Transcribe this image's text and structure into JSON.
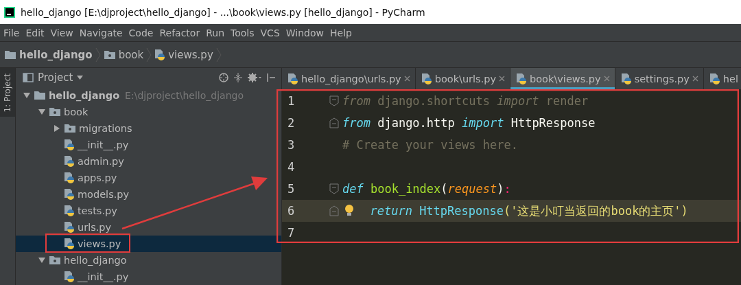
{
  "window": {
    "title": "hello_django [E:\\djproject\\hello_django] - ...\\book\\views.py [hello_django] - PyCharm"
  },
  "menu": [
    "File",
    "Edit",
    "View",
    "Navigate",
    "Code",
    "Refactor",
    "Run",
    "Tools",
    "VCS",
    "Window",
    "Help"
  ],
  "breadcrumbs": [
    {
      "label": "hello_django",
      "kind": "project"
    },
    {
      "label": "book",
      "kind": "folder"
    },
    {
      "label": "views.py",
      "kind": "file"
    }
  ],
  "side_strip": {
    "label": "1: Project"
  },
  "project_panel": {
    "title": "Project",
    "tree": [
      {
        "label": "hello_django",
        "kind": "project",
        "note": "E:\\djproject\\hello_django",
        "expanded": true,
        "selected": false,
        "children": [
          {
            "label": "book",
            "kind": "package",
            "expanded": true,
            "selected": false,
            "children": [
              {
                "label": "migrations",
                "kind": "package",
                "expanded": false,
                "selected": false
              },
              {
                "label": "__init__.py",
                "kind": "file",
                "selected": false
              },
              {
                "label": "admin.py",
                "kind": "file",
                "selected": false
              },
              {
                "label": "apps.py",
                "kind": "file",
                "selected": false
              },
              {
                "label": "models.py",
                "kind": "file",
                "selected": false
              },
              {
                "label": "tests.py",
                "kind": "file",
                "selected": false
              },
              {
                "label": "urls.py",
                "kind": "file",
                "selected": false
              },
              {
                "label": "views.py",
                "kind": "file",
                "selected": true
              }
            ]
          },
          {
            "label": "hello_django",
            "kind": "package",
            "expanded": true,
            "selected": false,
            "children": [
              {
                "label": "__init__.py",
                "kind": "file",
                "selected": false
              }
            ]
          }
        ]
      }
    ]
  },
  "tabs": [
    {
      "label": "hello_django\\urls.py",
      "selected": false,
      "closable": true
    },
    {
      "label": "book\\urls.py",
      "selected": false,
      "closable": true
    },
    {
      "label": "book\\views.py",
      "selected": true,
      "closable": true
    },
    {
      "label": "settings.py",
      "selected": false,
      "closable": true
    },
    {
      "label": "hel",
      "selected": false,
      "closable": false
    }
  ],
  "editor": {
    "lines": [
      {
        "number": "1",
        "fold_open": true,
        "fold_close": false,
        "current": false,
        "bulb": false,
        "tokens": [
          {
            "text": "from",
            "kind": "unused-kw"
          },
          {
            "text": " django.shortcuts ",
            "kind": "unused"
          },
          {
            "text": "import",
            "kind": "unused-kw"
          },
          {
            "text": " render",
            "kind": "unused"
          }
        ]
      },
      {
        "number": "2",
        "fold_open": false,
        "fold_close": true,
        "current": false,
        "bulb": false,
        "tokens": [
          {
            "text": "from",
            "kind": "kw"
          },
          {
            "text": " django.http ",
            "kind": "plain"
          },
          {
            "text": "import",
            "kind": "kw"
          },
          {
            "text": " HttpResponse",
            "kind": "plain"
          }
        ]
      },
      {
        "number": "3",
        "fold_open": false,
        "fold_close": false,
        "current": false,
        "bulb": false,
        "tokens": [
          {
            "text": "# Create your views here.",
            "kind": "comment"
          }
        ]
      },
      {
        "number": "4",
        "fold_open": false,
        "fold_close": false,
        "current": false,
        "bulb": false
      },
      {
        "number": "5",
        "fold_open": true,
        "fold_close": false,
        "current": false,
        "bulb": false,
        "tokens": [
          {
            "text": "def",
            "kind": "kw"
          },
          {
            "text": " book_index",
            "kind": "fn"
          },
          {
            "text": "(",
            "kind": "plain"
          },
          {
            "text": "request",
            "kind": "param"
          },
          {
            "text": ")",
            "kind": "plain"
          },
          {
            "text": ":",
            "kind": "colon"
          }
        ]
      },
      {
        "number": "6",
        "fold_open": false,
        "fold_close": true,
        "current": true,
        "bulb": true,
        "tokens": [
          {
            "text": "  return",
            "kind": "kw"
          },
          {
            "text": " HttpResponse",
            "kind": "builtin"
          },
          {
            "text": "('这是小叮当返回的book的主页')",
            "kind": "str"
          }
        ]
      },
      {
        "number": "7",
        "fold_open": false,
        "fold_close": false,
        "current": false,
        "bulb": false
      }
    ]
  }
}
